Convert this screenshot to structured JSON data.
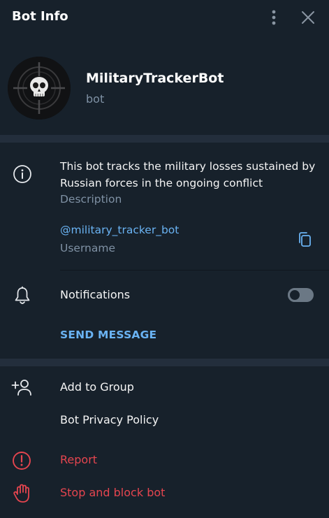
{
  "header": {
    "title": "Bot Info"
  },
  "profile": {
    "name": "MilitaryTrackerBot",
    "type": "bot"
  },
  "info": {
    "description": "This bot tracks the military losses sustained by Russian forces in the ongoing conflict",
    "description_label": "Description",
    "username": "@military_tracker_bot",
    "username_label": "Username"
  },
  "notifications": {
    "label": "Notifications",
    "enabled": false
  },
  "send_message": "SEND MESSAGE",
  "actions": {
    "add_to_group": "Add to Group",
    "privacy_policy": "Bot Privacy Policy",
    "report": "Report",
    "stop_block": "Stop and block bot"
  },
  "colors": {
    "background": "#17212b",
    "separator": "#232e3c",
    "accent": "#6ab3f3",
    "danger": "#e5454f",
    "muted": "#7f91a4"
  }
}
